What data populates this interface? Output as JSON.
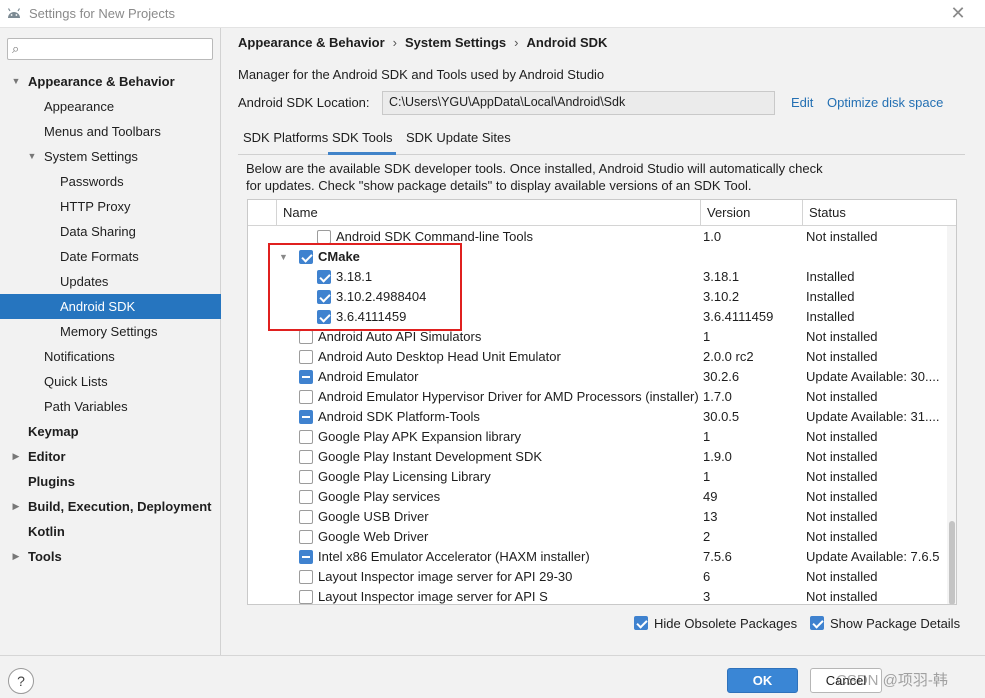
{
  "window": {
    "title": "Settings for New Projects"
  },
  "sidebar": {
    "search_placeholder": "",
    "items": [
      {
        "label": "Appearance & Behavior",
        "bold": true,
        "arrow": "down"
      },
      {
        "label": "Appearance"
      },
      {
        "label": "Menus and Toolbars"
      },
      {
        "label": "System Settings",
        "arrow": "down"
      },
      {
        "label": "Passwords"
      },
      {
        "label": "HTTP Proxy"
      },
      {
        "label": "Data Sharing"
      },
      {
        "label": "Date Formats"
      },
      {
        "label": "Updates"
      },
      {
        "label": "Android SDK",
        "selected": true
      },
      {
        "label": "Memory Settings"
      },
      {
        "label": "Notifications"
      },
      {
        "label": "Quick Lists"
      },
      {
        "label": "Path Variables"
      },
      {
        "label": "Keymap",
        "bold": true
      },
      {
        "label": "Editor",
        "bold": true,
        "arrow": "right"
      },
      {
        "label": "Plugins",
        "bold": true
      },
      {
        "label": "Build, Execution, Deployment",
        "bold": true,
        "arrow": "right"
      },
      {
        "label": "Kotlin",
        "bold": true
      },
      {
        "label": "Tools",
        "bold": true,
        "arrow": "right"
      }
    ]
  },
  "breadcrumb": [
    "Appearance & Behavior",
    "System Settings",
    "Android SDK"
  ],
  "description": "Manager for the Android SDK and Tools used by Android Studio",
  "sdk_location": {
    "label": "Android SDK Location:",
    "value": "C:\\Users\\YGU\\AppData\\Local\\Android\\Sdk",
    "edit_link": "Edit",
    "optimize_link": "Optimize disk space"
  },
  "tabs": [
    {
      "label": "SDK Platforms"
    },
    {
      "label": "SDK Tools",
      "active": true
    },
    {
      "label": "SDK Update Sites"
    }
  ],
  "panel_text": [
    "Below are the available SDK developer tools. Once installed, Android Studio will automatically check",
    "for updates. Check \"show package details\" to display available versions of an SDK Tool."
  ],
  "table": {
    "columns": [
      "Name",
      "Version",
      "Status"
    ],
    "rows": [
      {
        "name": "Android SDK Command-line Tools",
        "version": "1.0",
        "status": "Not installed",
        "check": "none",
        "level": 1
      },
      {
        "name": "CMake",
        "version": "",
        "status": "",
        "check": "checked",
        "level": 0,
        "bold": true,
        "expanded": true
      },
      {
        "name": "3.18.1",
        "version": "3.18.1",
        "status": "Installed",
        "check": "checked",
        "level": 1
      },
      {
        "name": "3.10.2.4988404",
        "version": "3.10.2",
        "status": "Installed",
        "check": "checked",
        "level": 1
      },
      {
        "name": "3.6.4111459",
        "version": "3.6.4111459",
        "status": "Installed",
        "check": "checked",
        "level": 1
      },
      {
        "name": "Android Auto API Simulators",
        "version": "1",
        "status": "Not installed",
        "check": "none",
        "level": 0
      },
      {
        "name": "Android Auto Desktop Head Unit Emulator",
        "version": "2.0.0 rc2",
        "status": "Not installed",
        "check": "none",
        "level": 0
      },
      {
        "name": "Android Emulator",
        "version": "30.2.6",
        "status": "Update Available: 30....",
        "check": "partial",
        "level": 0
      },
      {
        "name": "Android Emulator Hypervisor Driver for AMD Processors (installer)",
        "version": "1.7.0",
        "status": "Not installed",
        "check": "none",
        "level": 0
      },
      {
        "name": "Android SDK Platform-Tools",
        "version": "30.0.5",
        "status": "Update Available: 31....",
        "check": "partial",
        "level": 0
      },
      {
        "name": "Google Play APK Expansion library",
        "version": "1",
        "status": "Not installed",
        "check": "none",
        "level": 0
      },
      {
        "name": "Google Play Instant Development SDK",
        "version": "1.9.0",
        "status": "Not installed",
        "check": "none",
        "level": 0
      },
      {
        "name": "Google Play Licensing Library",
        "version": "1",
        "status": "Not installed",
        "check": "none",
        "level": 0
      },
      {
        "name": "Google Play services",
        "version": "49",
        "status": "Not installed",
        "check": "none",
        "level": 0
      },
      {
        "name": "Google USB Driver",
        "version": "13",
        "status": "Not installed",
        "check": "none",
        "level": 0
      },
      {
        "name": "Google Web Driver",
        "version": "2",
        "status": "Not installed",
        "check": "none",
        "level": 0
      },
      {
        "name": "Intel x86 Emulator Accelerator (HAXM installer)",
        "version": "7.5.6",
        "status": "Update Available: 7.6.5",
        "check": "partial",
        "level": 0
      },
      {
        "name": "Layout Inspector image server for API 29-30",
        "version": "6",
        "status": "Not installed",
        "check": "none",
        "level": 0
      },
      {
        "name": "Layout Inspector image server for API S",
        "version": "3",
        "status": "Not installed",
        "check": "none",
        "level": 0
      }
    ]
  },
  "options": {
    "hide_obsolete": "Hide Obsolete Packages",
    "show_details": "Show Package Details"
  },
  "buttons": {
    "help": "?",
    "ok": "OK",
    "cancel": "Cancel"
  },
  "watermark": "CSDN @项羽-韩",
  "colors": {
    "accent": "#2675bf",
    "link": "#2470b3",
    "highlight": "#e0201f"
  }
}
